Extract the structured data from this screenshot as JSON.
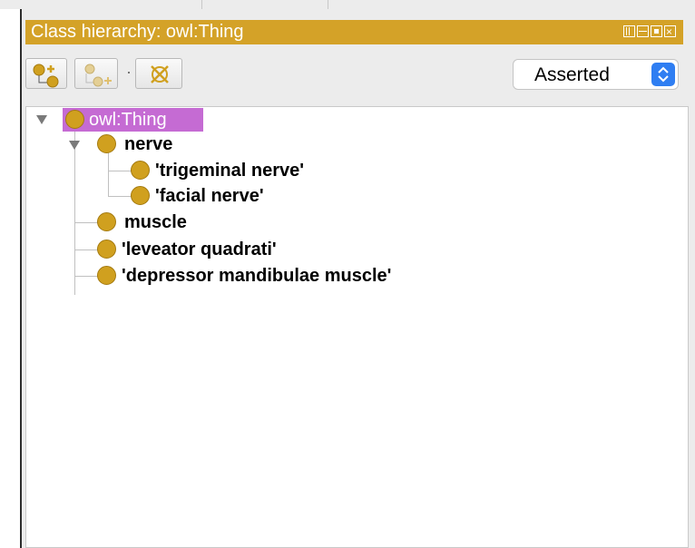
{
  "panel": {
    "title": "Class hierarchy: owl:Thing",
    "accent_color": "#d4a228",
    "selected_color": "#c56bd3",
    "class_color": "#d0a01f"
  },
  "toolbar": {
    "add_subclass_icon": "add-subclass-icon",
    "add_sibling_icon": "add-sibling-icon",
    "delete_class_icon": "delete-class-icon",
    "view_mode": "Asserted"
  },
  "tree": {
    "root": "owl:Thing",
    "nodes": [
      "nerve",
      "'trigeminal nerve'",
      "'facial nerve'",
      "muscle",
      "'leveator quadrati'",
      "'depressor mandibulae muscle'"
    ]
  }
}
